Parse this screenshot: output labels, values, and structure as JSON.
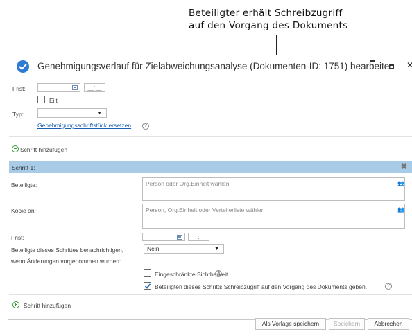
{
  "callout": {
    "line1": "Beteiligter erhält Schreibzugriff",
    "line2": "auf den Vorgang des Dokuments"
  },
  "window": {
    "title": "Genehmigungsverlauf für Zielabweichungsanalyse (Dokumenten-ID: 1751) bearbeiten",
    "icon": "checkmark-circle-icon",
    "controls": [
      "minimize-icon",
      "maximize-icon",
      "close-icon"
    ],
    "accent": "#2e7bd1"
  },
  "form": {
    "frist_label": "Frist:",
    "time_placeholder": "__:__",
    "eilt_label": "Eilt",
    "typ_label": "Typ:",
    "replace_link": "Genehmigungsschriftstück ersetzen",
    "help": "?"
  },
  "add_step_top": "Schritt hinzufügen",
  "step": {
    "title": "Schritt 1:",
    "close": "✖",
    "header_color": "#a8cce8",
    "beteiligte_label": "Beteiligte:",
    "beteiligte_placeholder": "Person oder Org.Einheit wählen",
    "kopie_label": "Kopie an:",
    "kopie_placeholder": "Person, Org.Einheit oder Verteilerliste wählen",
    "frist_label": "Frist:",
    "time_placeholder": "__:__",
    "notify_label_1": "Beteiligte dieses Schrittes benachrichtigen,",
    "notify_label_2": "wenn Änderungen vorgenommen wurden:",
    "notify_value": "Nein",
    "restricted_label": "Eingeschränkte Sichtbarkeit",
    "restricted_checked": false,
    "write_access_label": "Beteiligten dieses Schritts Schreibzugriff auf den Vorgang des Dokuments geben.",
    "write_access_checked": true,
    "help": "?"
  },
  "add_step_bottom": "Schritt hinzufügen",
  "buttons": {
    "save_template": "Als Vorlage speichern",
    "save": "Speichern",
    "cancel": "Abbrechen"
  }
}
